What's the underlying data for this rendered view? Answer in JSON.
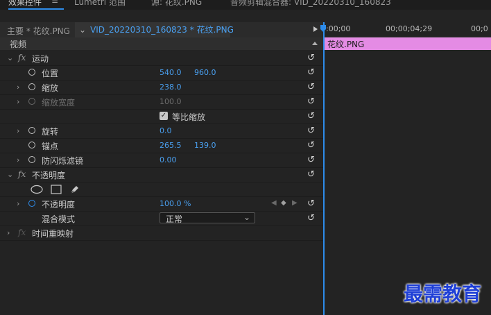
{
  "tabs": [
    {
      "label": "效果控件"
    },
    {
      "label": "≡"
    },
    {
      "label": "Lumetri 范围"
    },
    {
      "label": "源: 花纹.PNG"
    },
    {
      "label": "音频剪辑混合器: VID_20220310_160823"
    }
  ],
  "clip": {
    "master_label": "主要 * 花纹.PNG",
    "sequence_label": "VID_20220310_160823 * 花纹.PNG"
  },
  "section_header": "视频",
  "timeline": {
    "ticks": [
      ":00;00",
      "00;00;04;29",
      "00;0"
    ],
    "clip_name": "花纹.PNG",
    "clip_color": "#e48be4"
  },
  "motion": {
    "title": "运动",
    "position": {
      "label": "位置",
      "x": "540.0",
      "y": "960.0"
    },
    "scale": {
      "label": "缩放",
      "value": "238.0"
    },
    "scale_width": {
      "label": "缩放宽度",
      "value": "100.0"
    },
    "uniform_scale": {
      "label": "等比缩放",
      "checked": true
    },
    "rotation": {
      "label": "旋转",
      "value": "0.0"
    },
    "anchor": {
      "label": "锚点",
      "x": "265.5",
      "y": "139.0"
    },
    "anti_flicker": {
      "label": "防闪烁滤镜",
      "value": "0.00"
    }
  },
  "opacity": {
    "title": "不透明度",
    "opacity": {
      "label": "不透明度",
      "value": "100.0 %"
    },
    "blend_mode": {
      "label": "混合模式",
      "value": "正常"
    }
  },
  "time_remap": {
    "title": "时间重映射"
  },
  "watermark": "最需教育",
  "colors": {
    "accent": "#2d8ceb",
    "value_blue": "#4aa0f0"
  }
}
